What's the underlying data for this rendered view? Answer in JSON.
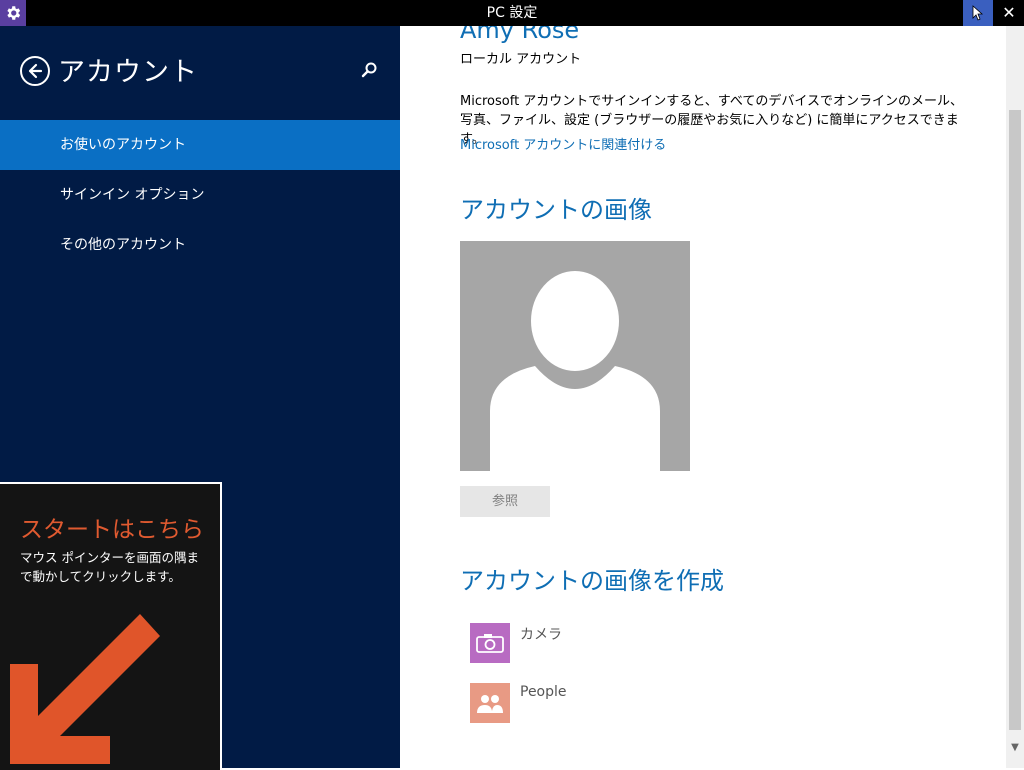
{
  "window": {
    "title": "PC 設定",
    "close_glyph": "✕",
    "app_icon": "gear-icon"
  },
  "sidebar": {
    "title": "アカウント",
    "items": [
      {
        "label": "お使いのアカウント",
        "selected": true
      },
      {
        "label": "サインイン オプション",
        "selected": false
      },
      {
        "label": "その他のアカウント",
        "selected": false
      }
    ]
  },
  "start_tip": {
    "title": "スタートはこちら",
    "body": "マウス ポインターを画面の隅まで動かしてクリックします。"
  },
  "account": {
    "name": "Amy Rose",
    "type": "ローカル アカウント",
    "description": "Microsoft アカウントでサインインすると、すべてのデバイスでオンラインのメール、写真、ファイル、設定 (ブラウザーの履歴やお気に入りなど) に簡単にアクセスできます。",
    "link_label": "Microsoft アカウントに関連付ける"
  },
  "picture": {
    "heading": "アカウントの画像",
    "browse_label": "参照"
  },
  "create": {
    "heading": "アカウントの画像を作成",
    "apps": [
      {
        "label": "カメラ",
        "icon": "camera-icon",
        "color": "#b86bc2"
      },
      {
        "label": "People",
        "icon": "people-icon",
        "color": "#e89a84"
      }
    ]
  },
  "colors": {
    "sidebar_bg": "#011b45",
    "selected_item": "#0a6fc4",
    "accent_text": "#0f6eb4",
    "start_tip_title": "#e05a30"
  }
}
